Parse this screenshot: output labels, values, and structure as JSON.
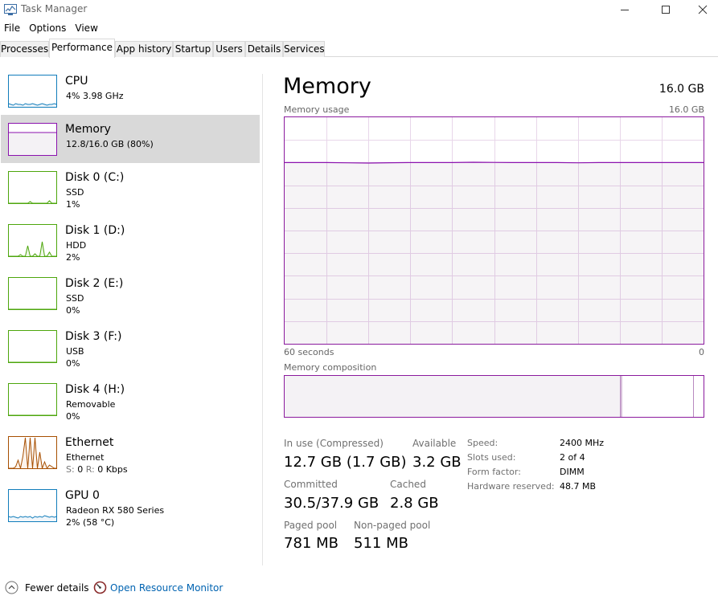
{
  "window": {
    "title": "Task Manager"
  },
  "menu": [
    "File",
    "Options",
    "View"
  ],
  "tabs": [
    "Processes",
    "Performance",
    "App history",
    "Startup",
    "Users",
    "Details",
    "Services"
  ],
  "active_tab": "Performance",
  "resources": [
    {
      "name": "CPU",
      "line1": "4% 3.98 GHz",
      "line2": "",
      "color": "#117dbb",
      "fill": "#f1f6fa"
    },
    {
      "name": "Memory",
      "line1": "12.8/16.0 GB (80%)",
      "line2": "",
      "color": "#8b12ae",
      "fill": "#f4f2f5"
    },
    {
      "name": "Disk 0 (C:)",
      "line1": "SSD",
      "line2": "1%",
      "color": "#4da60c",
      "fill": "#eff7e9"
    },
    {
      "name": "Disk 1 (D:)",
      "line1": "HDD",
      "line2": "2%",
      "color": "#4da60c",
      "fill": "#eff7e9"
    },
    {
      "name": "Disk 2 (E:)",
      "line1": "SSD",
      "line2": "0%",
      "color": "#4da60c",
      "fill": "#eff7e9"
    },
    {
      "name": "Disk 3 (F:)",
      "line1": "USB",
      "line2": "0%",
      "color": "#4da60c",
      "fill": "#eff7e9"
    },
    {
      "name": "Disk 4 (H:)",
      "line1": "Removable",
      "line2": "0%",
      "color": "#4da60c",
      "fill": "#eff7e9"
    },
    {
      "name": "Ethernet",
      "line1": "Ethernet",
      "line2_label_s": "S:",
      "line2_s": "0",
      "line2_label_r": "R:",
      "line2_r": "0 Kbps",
      "color": "#a74f01",
      "fill": "#fcf3eb"
    },
    {
      "name": "GPU 0",
      "line1": "Radeon RX 580 Series",
      "line2": "2% (58 °C)",
      "color": "#117dbb",
      "fill": "#f1f6fa"
    }
  ],
  "detail": {
    "title": "Memory",
    "total": "16.0 GB",
    "usage_label": "Memory usage",
    "usage_max": "16.0 GB",
    "axis_left": "60 seconds",
    "axis_right": "0",
    "composition_label": "Memory composition",
    "usage_fraction": 0.8,
    "accent": "#8b12ae",
    "stats": {
      "in_use_label": "In use (Compressed)",
      "in_use_value": "12.7 GB (1.7 GB)",
      "available_label": "Available",
      "available_value": "3.2 GB",
      "committed_label": "Committed",
      "committed_value": "30.5/37.9 GB",
      "cached_label": "Cached",
      "cached_value": "2.8 GB",
      "paged_label": "Paged pool",
      "paged_value": "781 MB",
      "nonpaged_label": "Non-paged pool",
      "nonpaged_value": "511 MB"
    },
    "specs": [
      {
        "label": "Speed:",
        "value": "2400 MHz"
      },
      {
        "label": "Slots used:",
        "value": "2 of 4"
      },
      {
        "label": "Form factor:",
        "value": "DIMM"
      },
      {
        "label": "Hardware reserved:",
        "value": "48.7 MB"
      }
    ]
  },
  "footer": {
    "fewer_details": "Fewer details",
    "resource_monitor": "Open Resource Monitor"
  }
}
